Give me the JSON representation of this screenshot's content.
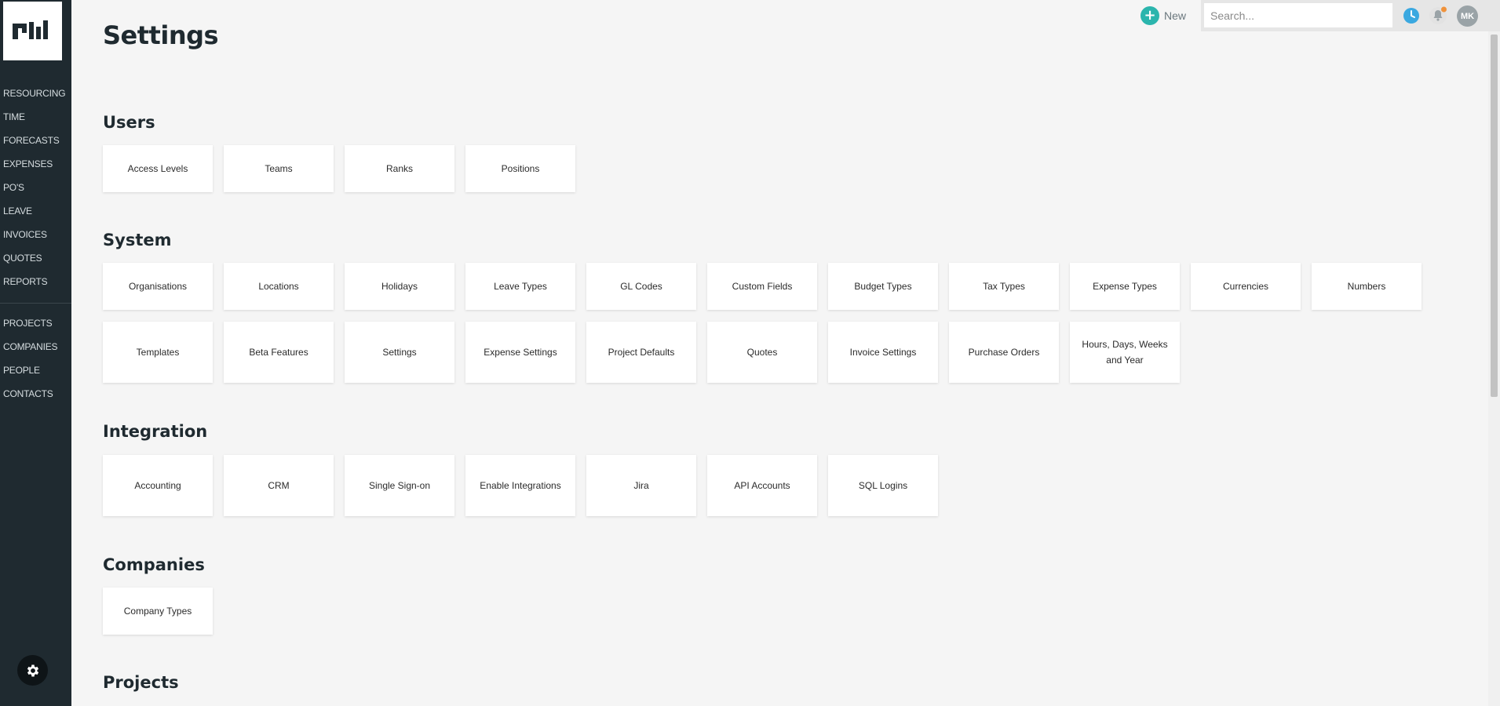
{
  "sidebar": {
    "nav_top": [
      "RESOURCING",
      "TIME",
      "FORECASTS",
      "EXPENSES",
      "PO'S",
      "LEAVE",
      "INVOICES",
      "QUOTES",
      "REPORTS"
    ],
    "nav_bottom": [
      "PROJECTS",
      "COMPANIES",
      "PEOPLE",
      "CONTACTS"
    ]
  },
  "topbar": {
    "new_label": "New",
    "search_placeholder": "Search...",
    "avatar_initials": "MK",
    "accent_color": "#2bb5ad",
    "clock_color": "#3aa8e0",
    "notification_dot_color": "#f0923b"
  },
  "page": {
    "title": "Settings"
  },
  "sections": {
    "users": {
      "title": "Users",
      "items": [
        "Access Levels",
        "Teams",
        "Ranks",
        "Positions"
      ]
    },
    "system": {
      "title": "System",
      "row1": [
        "Organisations",
        "Locations",
        "Holidays",
        "Leave Types",
        "GL Codes",
        "Custom Fields",
        "Budget Types",
        "Tax Types",
        "Expense Types",
        "Currencies",
        "Numbers"
      ],
      "row2": [
        "Templates",
        "Beta Features",
        "Settings",
        "Expense Settings",
        "Project Defaults",
        "Quotes",
        "Invoice Settings",
        "Purchase Orders",
        "Hours, Days, Weeks and Year"
      ]
    },
    "integration": {
      "title": "Integration",
      "items": [
        "Accounting",
        "CRM",
        "Single Sign-on",
        "Enable Integrations",
        "Jira",
        "API Accounts",
        "SQL Logins"
      ]
    },
    "companies": {
      "title": "Companies",
      "items": [
        "Company Types"
      ]
    },
    "projects": {
      "title": "Projects"
    }
  }
}
